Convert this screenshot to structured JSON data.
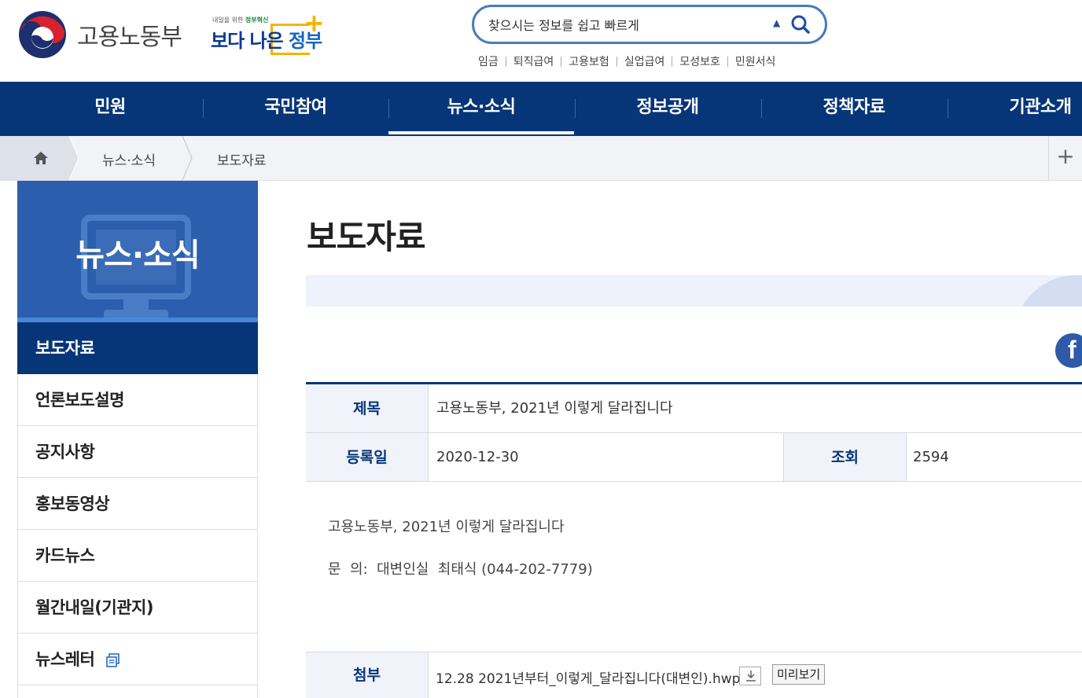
{
  "header": {
    "ministry_name": "고용노동부",
    "gov_tagline_prefix": "내일을 위한",
    "gov_tagline_highlight": "정부혁신",
    "gov_slogan_a": "보다 나은",
    "gov_slogan_b": "정부",
    "search": {
      "placeholder": "찾으시는 정보를 쉽고 빠르게"
    },
    "quick_links": [
      "임금",
      "퇴직급여",
      "고용보험",
      "실업급여",
      "모성보호",
      "민원서식"
    ]
  },
  "gnb": {
    "items": [
      "민원",
      "국민참여",
      "뉴스·소식",
      "정보공개",
      "정책자료",
      "기관소개"
    ],
    "active_index": 2
  },
  "breadcrumb": {
    "items": [
      "뉴스·소식",
      "보도자료"
    ]
  },
  "sidebar": {
    "title": "뉴스·소식",
    "items": [
      "보도자료",
      "언론보도설명",
      "공지사항",
      "홍보동영상",
      "카드뉴스",
      "월간내일(기관지)",
      "뉴스레터"
    ],
    "active_index": 0
  },
  "main": {
    "page_title": "보도자료",
    "fields": {
      "title_label": "제목",
      "title_value": "고용노동부, 2021년 이렇게 달라집니다",
      "date_label": "등록일",
      "date_value": "2020-12-30",
      "views_label": "조회",
      "views_value": "2594"
    },
    "body": {
      "line1": "고용노동부, 2021년 이렇게 달라집니다",
      "line2": "문  의:  대변인실  최태식 (044-202-7779)"
    },
    "attachment": {
      "label": "첨부",
      "file_name": "12.28 2021년부터_이렇게_달라집니다(대변인).hwp",
      "preview_label": "미리보기"
    }
  },
  "colors": {
    "navy": "#063678",
    "sidebar_blue": "#2b5fad",
    "accent_yellow": "#f5b300",
    "facebook": "#2f5aa8"
  }
}
